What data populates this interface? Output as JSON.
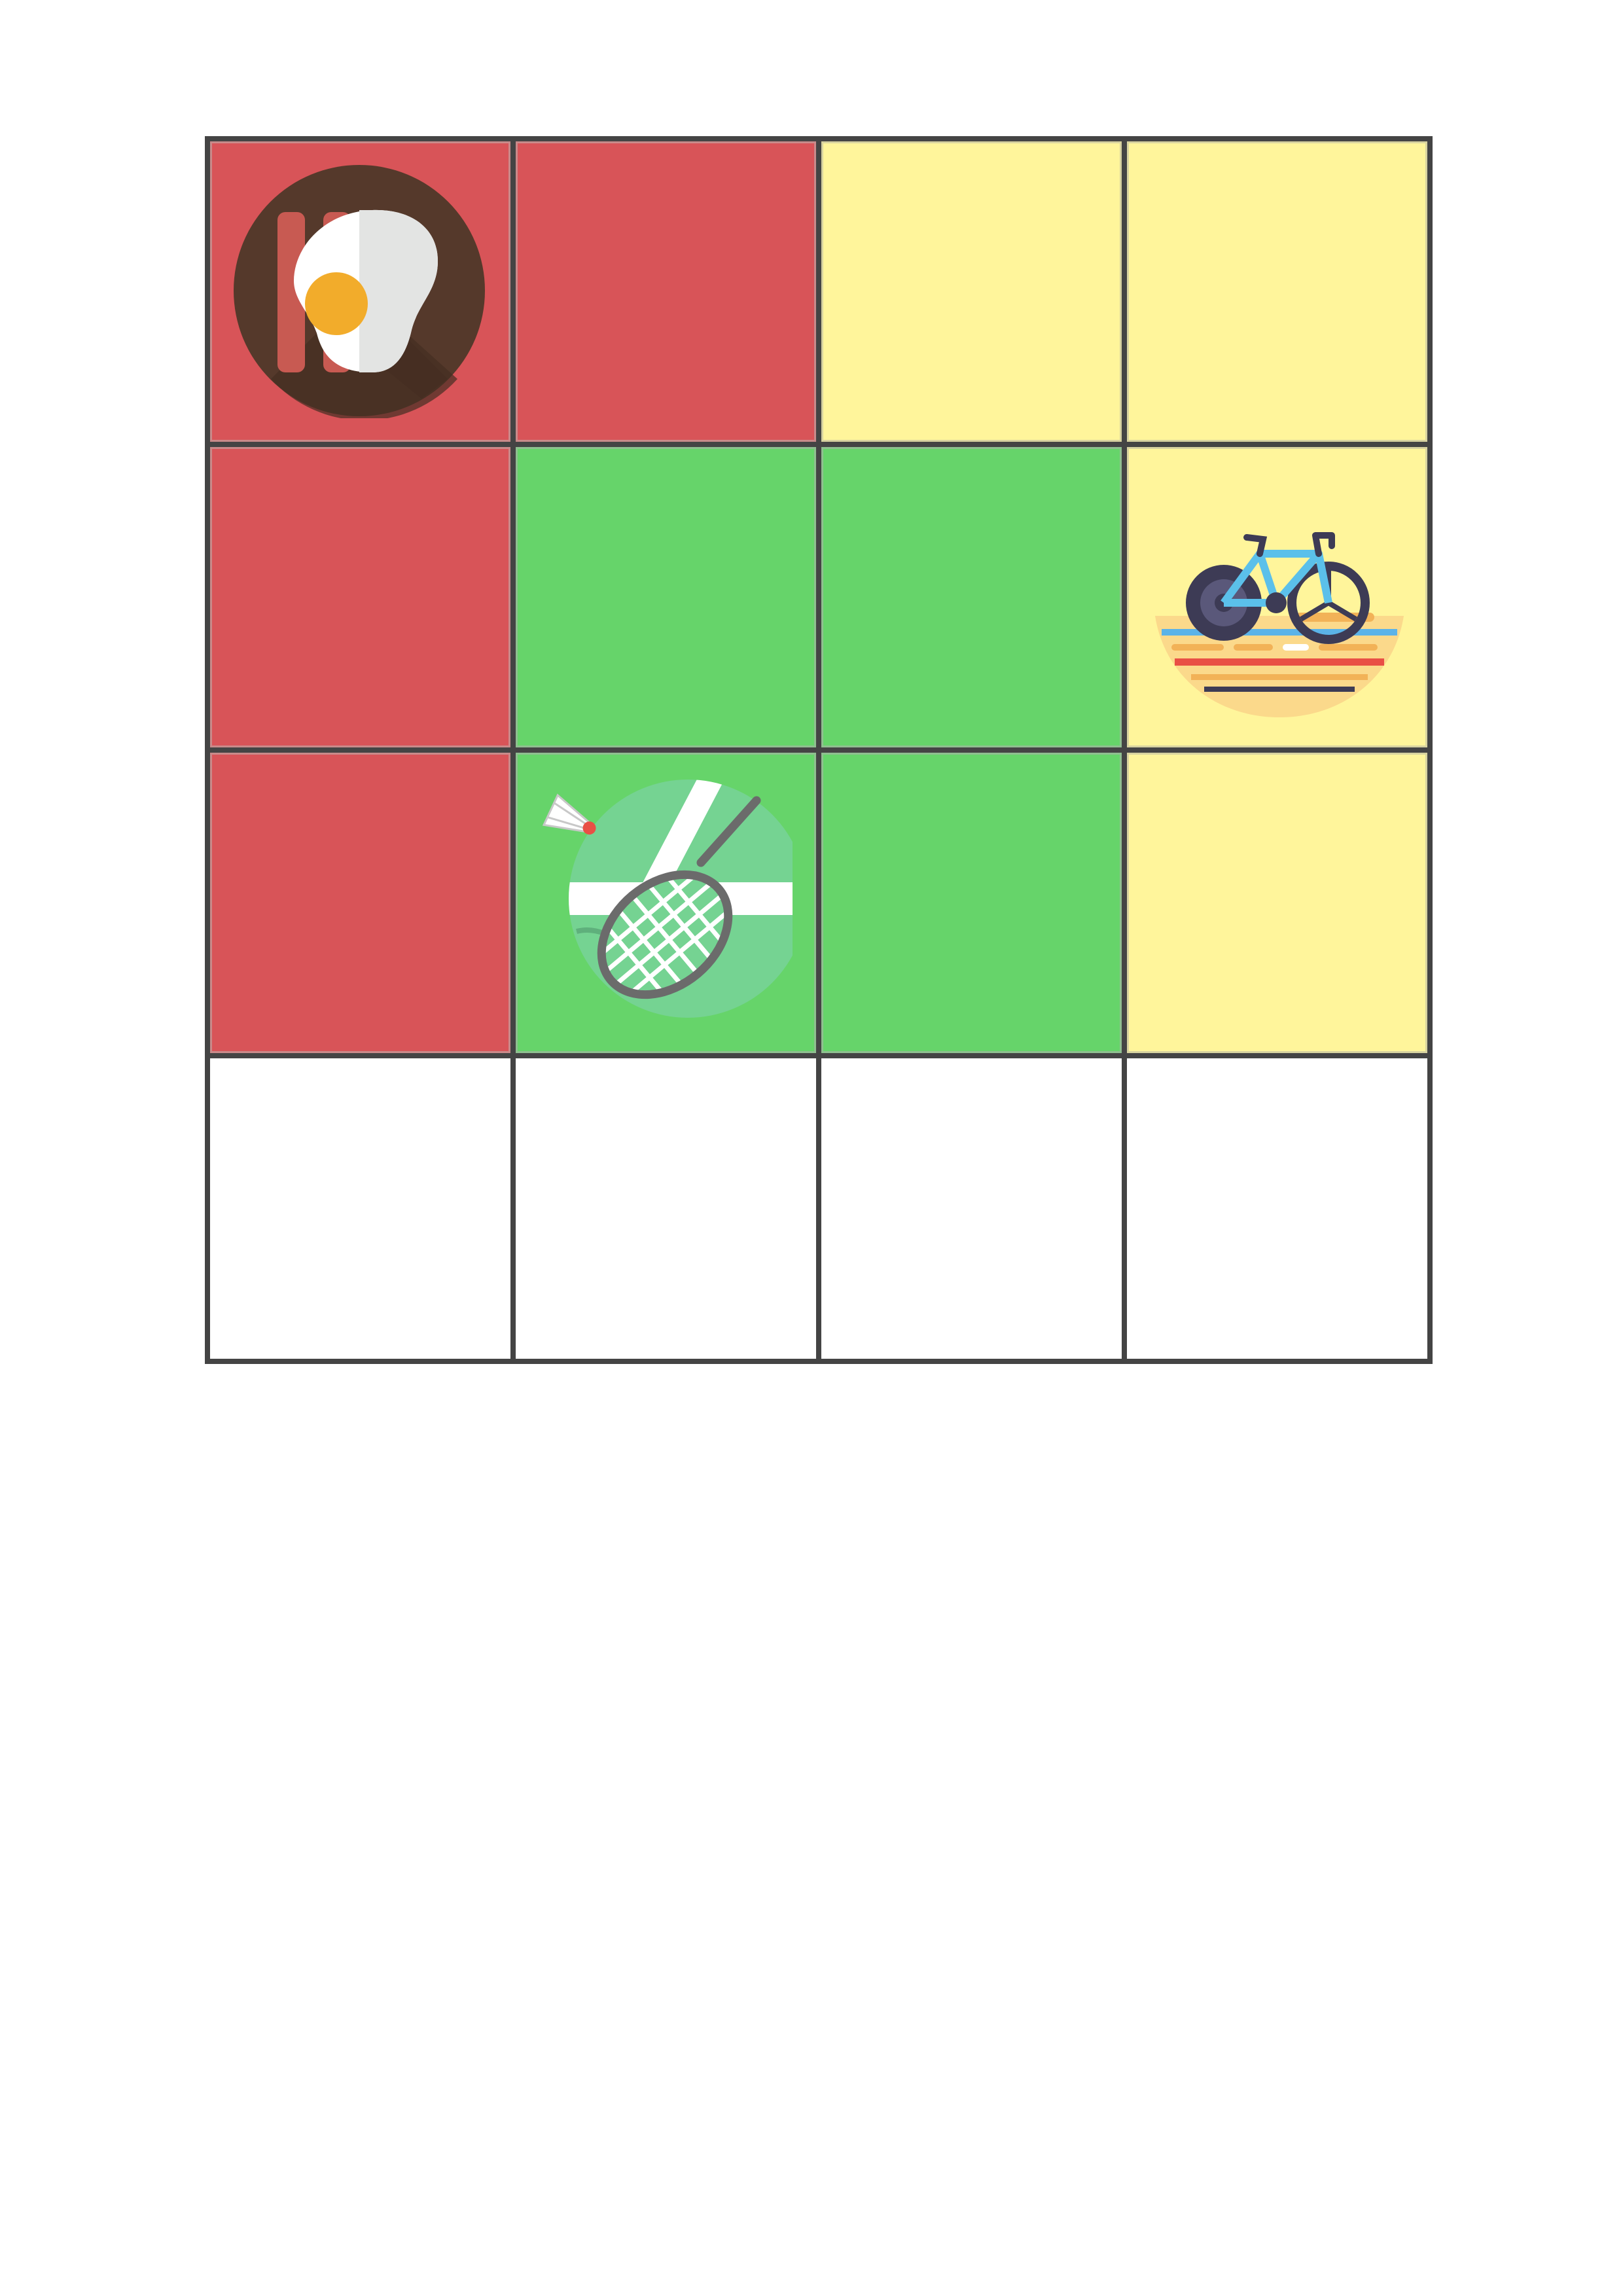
{
  "colors": {
    "red": "#d85458",
    "green": "#66d46a",
    "yellow": "#fff59b",
    "white": "#ffffff",
    "grid_line": "#444444"
  },
  "grid": {
    "rows": 4,
    "columns": 4,
    "cells": [
      [
        "red",
        "red",
        "yellow",
        "yellow"
      ],
      [
        "red",
        "green",
        "green",
        "yellow"
      ],
      [
        "red",
        "green",
        "green",
        "yellow"
      ],
      [
        "white",
        "white",
        "white",
        "white"
      ]
    ]
  },
  "icons": [
    {
      "name": "bacon-and-egg-icon",
      "row": 1,
      "column": 1
    },
    {
      "name": "track-cycling-icon",
      "row": 2,
      "column": 4
    },
    {
      "name": "badminton-icon",
      "row": 3,
      "column": 2
    }
  ]
}
